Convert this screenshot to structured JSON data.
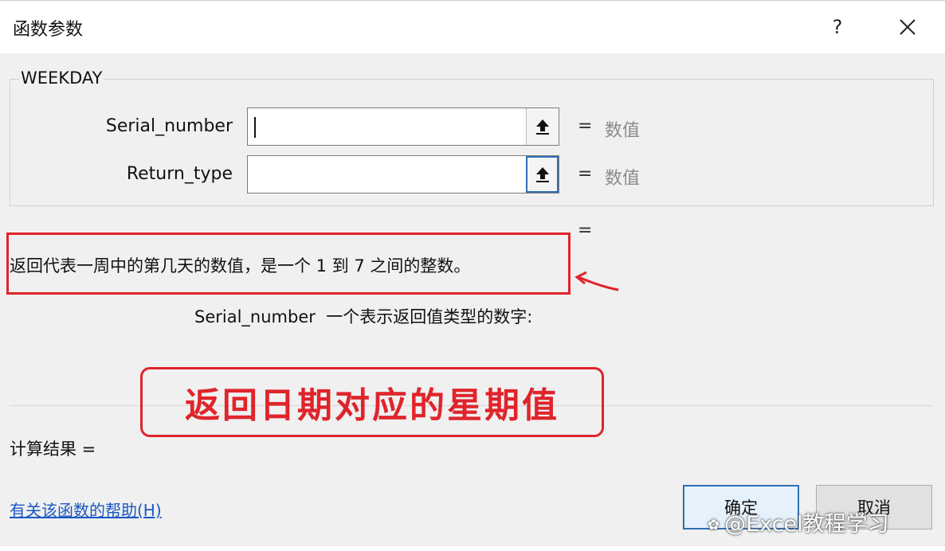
{
  "window": {
    "title": "函数参数",
    "help_label": "?",
    "close_icon": "close-icon"
  },
  "function": {
    "name": "WEEKDAY"
  },
  "arguments": [
    {
      "label": "Serial_number",
      "value": "",
      "eq": "=",
      "type_hint": "数值"
    },
    {
      "label": "Return_type",
      "value": "",
      "eq": "=",
      "type_hint": "数值"
    }
  ],
  "result_eq": "=",
  "description": "返回代表一周中的第几天的数值，是一个 1 到 7 之间的整数。",
  "argument_help": {
    "name": "Serial_number",
    "text": "一个表示返回值类型的数字:"
  },
  "annotation": {
    "banner_text": "返回日期对应的星期值",
    "color": "#e0242b"
  },
  "calc_result_label": "计算结果 =",
  "help_link": "有关该函数的帮助(H)",
  "buttons": {
    "ok": "确定",
    "cancel": "取消"
  },
  "watermark": "@Excel教程学习"
}
